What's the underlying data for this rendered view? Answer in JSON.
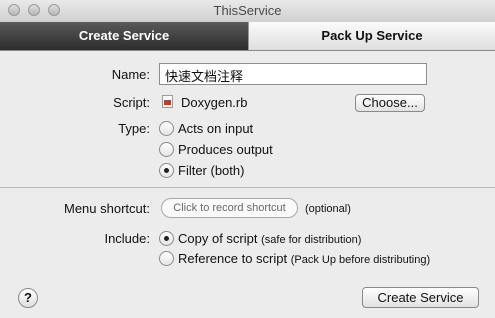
{
  "window": {
    "title": "ThisService"
  },
  "tabs": [
    {
      "label": "Create Service",
      "active": true
    },
    {
      "label": "Pack Up Service",
      "active": false
    }
  ],
  "form": {
    "name_label": "Name:",
    "name_value": "快速文档注释",
    "script_label": "Script:",
    "script_icon": "ruby-file-icon",
    "script_file": "Doxygen.rb",
    "choose_button": "Choose...",
    "type_label": "Type:",
    "type_options": [
      {
        "label": "Acts on input",
        "selected": false
      },
      {
        "label": "Produces output",
        "selected": false
      },
      {
        "label": "Filter (both)",
        "selected": true
      }
    ],
    "shortcut_label": "Menu shortcut:",
    "shortcut_placeholder": "Click to record shortcut",
    "shortcut_note": "(optional)",
    "include_label": "Include:",
    "include_options": [
      {
        "label": "Copy of script",
        "note": "(safe for distribution)",
        "selected": true
      },
      {
        "label": "Reference to script",
        "note": "(Pack Up before distributing)",
        "selected": false
      }
    ]
  },
  "footer": {
    "help": "?",
    "create_button": "Create Service"
  }
}
